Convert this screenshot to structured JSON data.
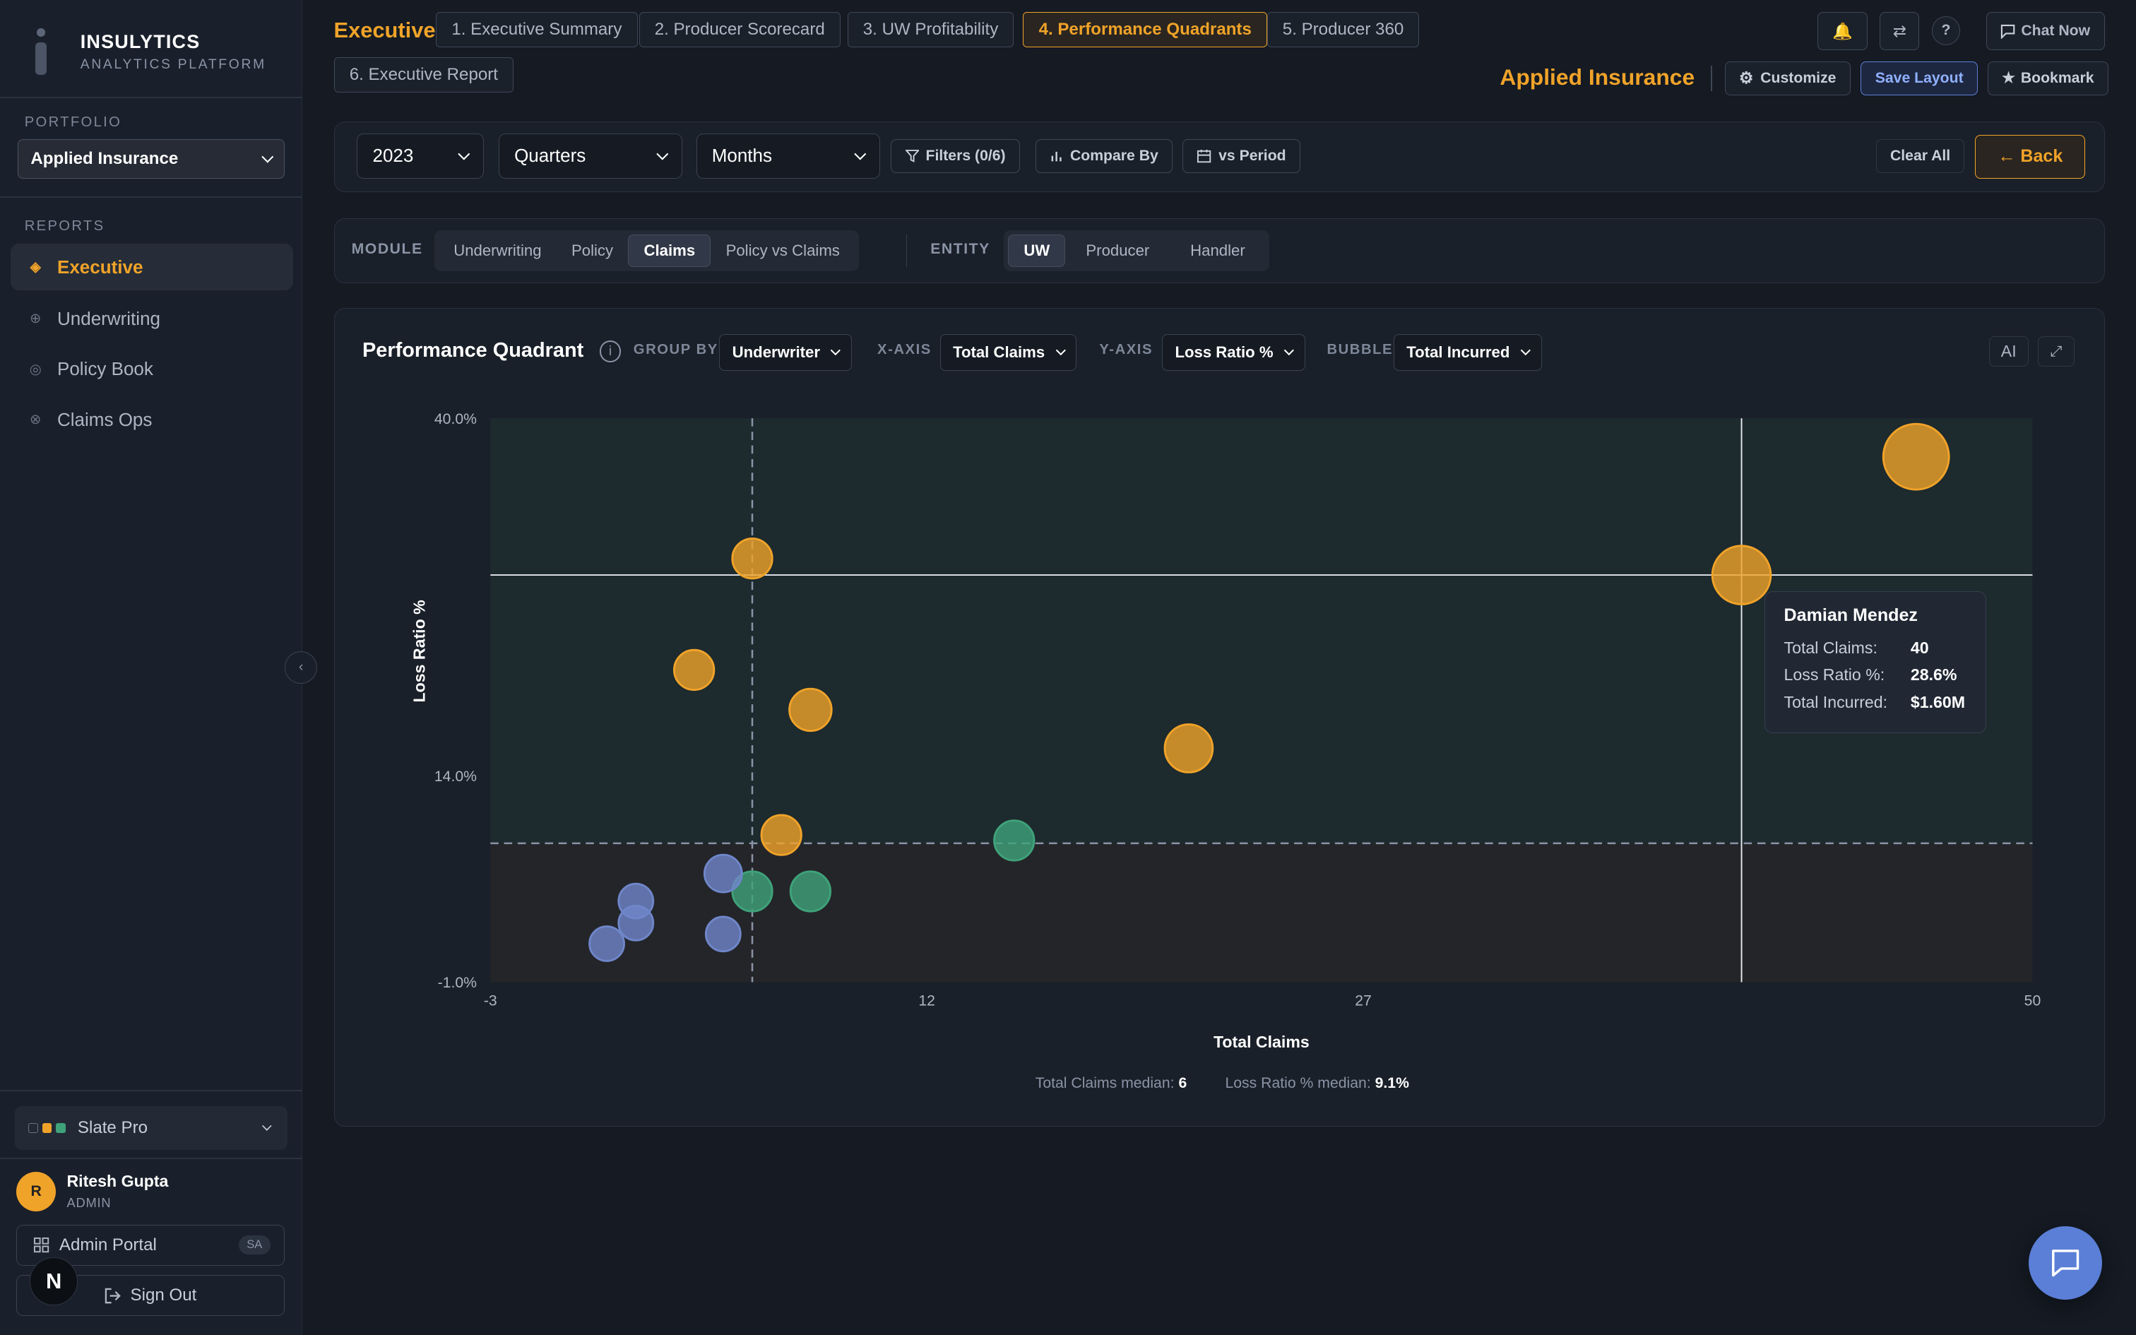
{
  "brand": {
    "name": "INSULYTICS",
    "subtitle": "ANALYTICS PLATFORM"
  },
  "sidebar": {
    "portfolio_label": "PORTFOLIO",
    "portfolio_value": "Applied Insurance",
    "reports_label": "REPORTS",
    "items": [
      {
        "label": "Executive",
        "icon": "diamond-icon",
        "active": true
      },
      {
        "label": "Underwriting",
        "icon": "crosshair-icon"
      },
      {
        "label": "Policy Book",
        "icon": "circle-icon"
      },
      {
        "label": "Claims Ops",
        "icon": "target-icon"
      }
    ],
    "collapse_icon": "‹",
    "theme": {
      "label": "Slate Pro",
      "swatches": [
        "#1a202b",
        "#f0a329",
        "#3fa27a"
      ]
    },
    "user": {
      "initial": "R",
      "name": "Ritesh Gupta",
      "role": "ADMIN"
    },
    "admin_portal": {
      "label": "Admin Portal",
      "badge": "SA"
    },
    "sign_out": {
      "label": "Sign Out"
    },
    "n_badge": "N"
  },
  "topbar": {
    "title": "Executive",
    "tabs": [
      {
        "label": "1. Executive Summary"
      },
      {
        "label": "2. Producer Scorecard"
      },
      {
        "label": "3. UW Profitability"
      },
      {
        "label": "4. Performance Quadrants",
        "active": true
      },
      {
        "label": "5. Producer 360"
      },
      {
        "label": "6. Executive Report"
      }
    ],
    "icons": {
      "bell": "🔔",
      "swap": "⇄",
      "help": "?"
    },
    "chat_now": "Chat Now",
    "company": "Applied Insurance",
    "customize": "Customize",
    "save_layout": "Save Layout",
    "bookmark": "Bookmark"
  },
  "filters": {
    "year": "2023",
    "quarters": "Quarters",
    "months": "Months",
    "filters_btn": "Filters (0/6)",
    "compare_by": "Compare By",
    "vs_period": "vs Period",
    "clear_all": "Clear All",
    "back": "← Back"
  },
  "module": {
    "label": "MODULE",
    "options": [
      "Underwriting",
      "Policy",
      "Claims",
      "Policy vs Claims"
    ],
    "active": "Claims",
    "entity_label": "ENTITY",
    "entity_options": [
      "UW",
      "Producer",
      "Handler"
    ],
    "entity_active": "UW"
  },
  "chart_panel": {
    "title": "Performance Quadrant",
    "group_by_label": "GROUP BY",
    "group_by": "Underwriter",
    "x_axis_label": "X-AXIS",
    "x_axis": "Total Claims",
    "y_axis_label": "Y-AXIS",
    "y_axis": "Loss Ratio %",
    "bubble_label": "BUBBLE",
    "bubble": "Total Incurred",
    "ai_btn": "AI",
    "expand_icon": "⤢",
    "median_x_label": "Total Claims median:",
    "median_x_value": "6",
    "median_y_label": "Loss Ratio % median:",
    "median_y_value": "9.1%"
  },
  "tooltip": {
    "name": "Damian Mendez",
    "rows": [
      {
        "k": "Total Claims:",
        "v": "40"
      },
      {
        "k": "Loss Ratio %:",
        "v": "28.6%"
      },
      {
        "k": "Total Incurred:",
        "v": "$1.60M"
      }
    ]
  },
  "chart_data": {
    "type": "scatter",
    "xlabel": "Total Claims",
    "ylabel": "Loss Ratio %",
    "xlim": [
      -3,
      50
    ],
    "ylim": [
      -1.0,
      40.0
    ],
    "x_ticks": [
      "-3",
      "12",
      "27",
      "50"
    ],
    "x_tick_values": [
      -3,
      12,
      27,
      50
    ],
    "y_ticks": [
      "40.0%",
      "14.0%",
      "-1.0%"
    ],
    "y_tick_values": [
      40.0,
      14.0,
      -1.0
    ],
    "median_x": 6,
    "median_y": 9.1,
    "crosshair": {
      "x": 40,
      "y": 28.6
    },
    "colors": {
      "high": "#f0a329",
      "mid": "#3fa27a",
      "low": "#6f86c9"
    },
    "points": [
      {
        "x": 46,
        "y": 37.2,
        "size": 2.2,
        "group": "high"
      },
      {
        "x": 40,
        "y": 28.6,
        "size": 1.6,
        "group": "high"
      },
      {
        "x": 6,
        "y": 29.8,
        "size": 0.5,
        "group": "high"
      },
      {
        "x": 4,
        "y": 21.7,
        "size": 0.5,
        "group": "high"
      },
      {
        "x": 8,
        "y": 18.8,
        "size": 0.6,
        "group": "high"
      },
      {
        "x": 21,
        "y": 16.0,
        "size": 0.9,
        "group": "high"
      },
      {
        "x": 7,
        "y": 9.7,
        "size": 0.5,
        "group": "high"
      },
      {
        "x": 15,
        "y": 9.3,
        "size": 0.5,
        "group": "mid"
      },
      {
        "x": 6,
        "y": 5.6,
        "size": 0.5,
        "group": "mid"
      },
      {
        "x": 8,
        "y": 5.6,
        "size": 0.5,
        "group": "mid"
      },
      {
        "x": 5,
        "y": 6.9,
        "size": 0.4,
        "group": "low"
      },
      {
        "x": 2,
        "y": 4.9,
        "size": 0.3,
        "group": "low"
      },
      {
        "x": 2,
        "y": 3.3,
        "size": 0.3,
        "group": "low"
      },
      {
        "x": 1,
        "y": 1.8,
        "size": 0.3,
        "group": "low"
      },
      {
        "x": 5,
        "y": 2.5,
        "size": 0.3,
        "group": "low"
      }
    ]
  }
}
